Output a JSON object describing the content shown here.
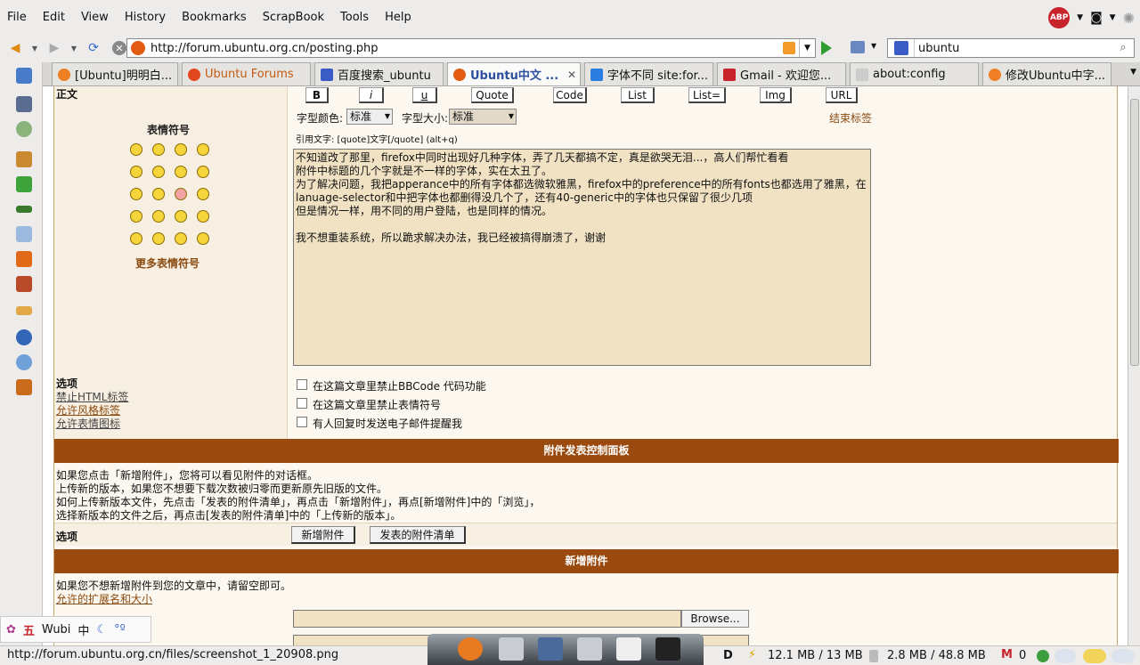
{
  "menu": [
    "File",
    "Edit",
    "View",
    "History",
    "Bookmarks",
    "ScrapBook",
    "Tools",
    "Help"
  ],
  "abp_label": "ABP",
  "url": "http://forum.ubuntu.org.cn/posting.php",
  "search": "ubuntu",
  "tabs": [
    {
      "label": "[Ubuntu]明明白...",
      "color": "#f07f26"
    },
    {
      "label": "Ubuntu Forums",
      "color": "#e3471d"
    },
    {
      "label": "百度搜索_ubuntu",
      "color": "#3b5cc4"
    },
    {
      "label": "Ubuntu中文 ...",
      "color": "#e25c12"
    },
    {
      "label": "字体不同 site:for...",
      "color": "#2a7de1"
    },
    {
      "label": "Gmail - 欢迎您...",
      "color": "#c8232b"
    },
    {
      "label": "about:config",
      "color": "#999999"
    },
    {
      "label": "修改Ubuntu中字...",
      "color": "#f07f26"
    }
  ],
  "post": {
    "body_label": "正文",
    "emoticons_label": "表情符号",
    "more_emoticons": "更多表情符号",
    "toolbar": [
      "B",
      "i",
      "u",
      "Quote",
      "Code",
      "List",
      "List=",
      "Img",
      "URL"
    ],
    "font_color_label": "字型颜色:",
    "font_color_value": "标准",
    "font_size_label": "字型大小:",
    "font_size_value": "标准",
    "close_tags": "结束标签",
    "hint": "引用文字: [quote]文字[/quote]  (alt+q)",
    "text": "不知道改了那里，firefox中同时出现好几种字体，弄了几天都搞不定，真是欲哭无泪...，高人们帮忙看看\n附件中标题的几个字就是不一样的字体，实在太丑了。\n为了解决问题，我把apperance中的所有字体都选微软雅黑，firefox中的preference中的所有fonts也都选用了雅黑，在lanuage-selector和中把字体也都删得没几个了，还有40-generic中的字体也只保留了很少几项\n但是情况一样，用不同的用户登陆，也是同样的情况。\n\n我不想重装系统，所以跪求解决办法，我已经被搞得崩溃了，谢谢"
  },
  "options": {
    "title": "选项",
    "left": [
      "禁止HTML标签",
      "允许风格标签",
      "允许表情图标"
    ],
    "checks": [
      "在这篇文章里禁止BBCode 代码功能",
      "在这篇文章里禁止表情符号",
      "有人回复时发送电子邮件提醒我"
    ]
  },
  "attach": {
    "header": "附件发表控制面板",
    "lines": [
      "如果您点击「新增附件」，您将可以看见附件的对话框。",
      "上传新的版本，如果您不想要下载次数被归零而更新原先旧版的文件。",
      "如何上传新版本文件，先点击「发表的附件清单」，再点击「新增附件」，再点[新增附件]中的「浏览」，",
      "选择新版本的文件之后，再点击[发表的附件清单]中的「上传新的版本」。"
    ],
    "options_label": "选项",
    "add_btn": "新增附件",
    "list_btn": "发表的附件清单",
    "new_header": "新增附件",
    "note": "如果您不想新增附件到您的文章中，请留空即可。",
    "ext_link": "允许的扩展名和大小",
    "browse": "Browse..."
  },
  "ime": {
    "name": "Wubi",
    "mode": "中"
  },
  "status": {
    "url": "http://forum.ubuntu.org.cn/files/screenshot_1_20908.png",
    "mem1": "12.1 MB / 13 MB",
    "mem2": "2.8 MB / 48.8 MB",
    "mail": "0"
  }
}
